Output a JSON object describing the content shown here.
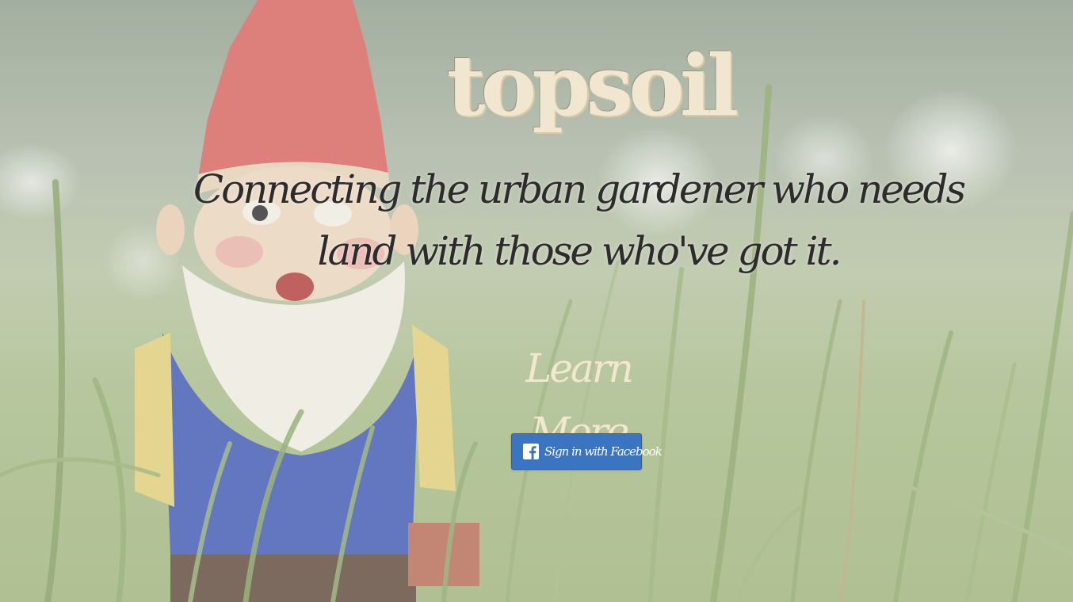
{
  "hero": {
    "logo_text": "topsoil",
    "tagline": "Connecting the urban gardener who needs land with those who've got it.",
    "learn_more_label": "Learn More",
    "facebook_button_label": "Sign in with Facebook"
  },
  "background": {
    "image_subject": "garden-gnome-in-grass"
  },
  "colors": {
    "logo": "#f1e6cf",
    "tagline": "#2d2b2b",
    "learn_more": "#f3e7cd",
    "facebook_button": "#3b74c0"
  },
  "icons": {
    "facebook": "facebook-icon"
  }
}
